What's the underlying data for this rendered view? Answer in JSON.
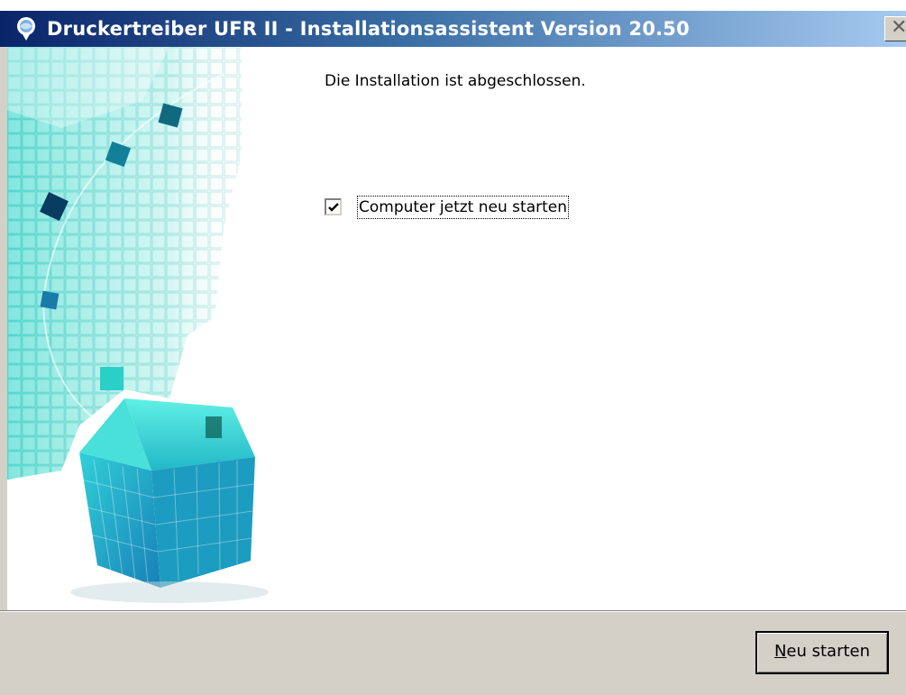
{
  "window": {
    "title": "Druckertreiber UFR II - Installationsassistent Version 20.50",
    "close_glyph": "✕",
    "app_icon": "printer-globe-icon"
  },
  "main": {
    "status_text": "Die Installation ist abgeschlossen.",
    "restart_checkbox": {
      "label": "Computer jetzt neu starten",
      "checked": true
    }
  },
  "footer": {
    "restart_button": {
      "mnemonic": "N",
      "rest": "eu starten"
    }
  },
  "colors": {
    "titlebar_start": "#0a246a",
    "titlebar_end": "#a6caf0",
    "dialog_face": "#d4d0c8",
    "art_cyan": "#2ad4c8"
  }
}
